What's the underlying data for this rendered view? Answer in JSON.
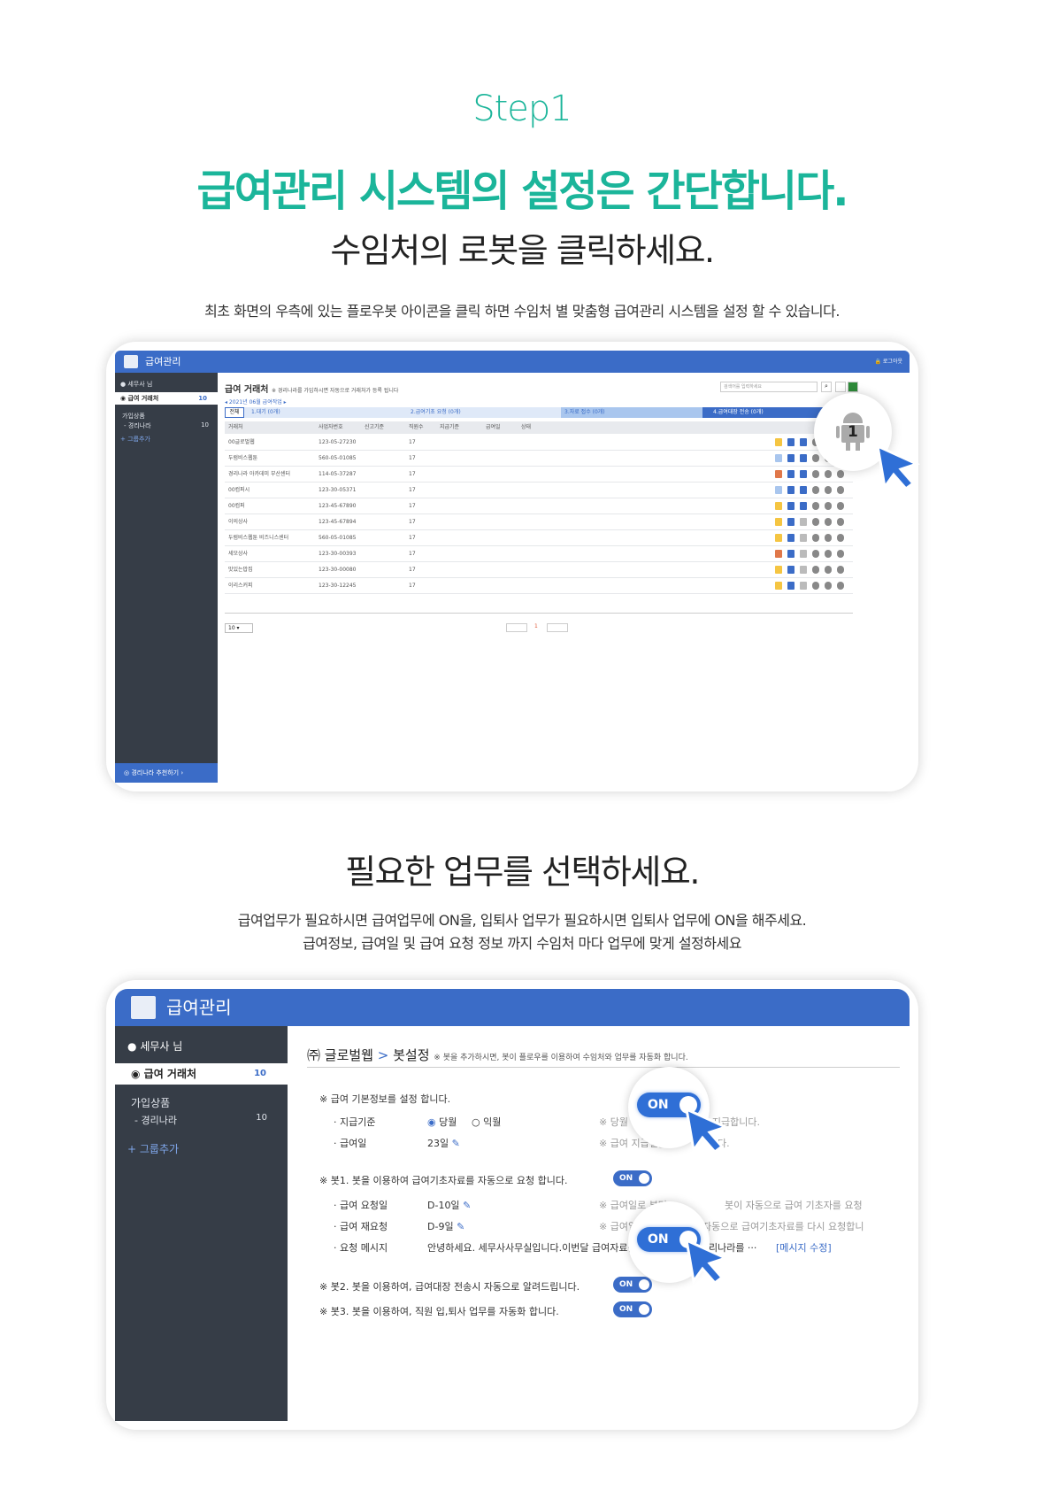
{
  "header": {
    "step": "Step1",
    "title": "급여관리 시스템의 설정은 간단합니다.",
    "subtitle1": "수임처의 로봇을 클릭하세요.",
    "desc1": "최초 화면의 우측에 있는 플로우봇 아이콘을 클릭 하면 수임처 별 맞춤형 급여관리 시스템을 설정 할 수 있습니다.",
    "subtitle2": "필요한 업무를 선택하세요.",
    "desc2_line1": "급여업무가 필요하시면 급여업무에 ON을, 입퇴사 업무가 필요하시면 입퇴사 업무에 ON을 해주세요.",
    "desc2_line2": "급여정보, 급여일 및 급여 요청 정보 까지 수임처 마다 업무에 맞게 설정하세요"
  },
  "screen1": {
    "app_title": "급여관리",
    "logout": "로그아웃",
    "user": "세무사 님",
    "menu_payroll": "급여 거래처",
    "menu_payroll_count": "10",
    "group_title": "가입상품",
    "group_item": "- 경리나라",
    "group_item_count": "10",
    "add_group": "+ 그룹추가",
    "recommend": "경리나라 추천하기",
    "page_title": "급여 거래처",
    "page_note": "※ 경리나라를 가입하시면 자동으로 거래처가 등록 됩니다",
    "search_placeholder": "검색어를 입력하세요",
    "month_nav": "◂ 2021년 06월 급여작업 ▸",
    "steps": [
      "전체",
      "1.대기 (0개)",
      "2.급여기초 요청 (0개)",
      "3.자료 접수 (0개)",
      "4.급여대장 전송 (0개)"
    ],
    "columns": [
      "거래처",
      "사업자번호",
      "신고기준",
      "직원수",
      "지급기준",
      "급여일",
      "상태"
    ],
    "rows": [
      {
        "name": "00글로벌웹",
        "biz": "123-05-27230",
        "cnt": "17"
      },
      {
        "name": "두럼비스웹툰",
        "biz": "560-05-01085",
        "cnt": "17"
      },
      {
        "name": "경리나라 아카데미 부산센터",
        "biz": "114-05-37287",
        "cnt": "17"
      },
      {
        "name": "00컴퍼시",
        "biz": "123-30-05371",
        "cnt": "17"
      },
      {
        "name": "00컴퍼",
        "biz": "123-45-67890",
        "cnt": "17"
      },
      {
        "name": "이의상사",
        "biz": "123-45-67894",
        "cnt": "17"
      },
      {
        "name": "두럼비스웹툰 비즈니스센터",
        "biz": "560-05-01085",
        "cnt": "17"
      },
      {
        "name": "세모상사",
        "biz": "123-30-00393",
        "cnt": "17"
      },
      {
        "name": "맛있는밥집",
        "biz": "123-30-00080",
        "cnt": "17"
      },
      {
        "name": "이리스커피",
        "biz": "123-30-12245",
        "cnt": "17"
      }
    ],
    "page_size": "10",
    "page_num": "1",
    "robot_badge": "1"
  },
  "screen2": {
    "app_title": "급여관리",
    "user": "세무사 님",
    "menu_payroll": "급여 거래처",
    "menu_payroll_count": "10",
    "group_title": "가입상품",
    "group_item": "- 경리나라",
    "group_item_count": "10",
    "add_group": "그룹추가",
    "page_company": "㈜ 글로벌웹",
    "page_sep": ">",
    "page_title": "봇설정",
    "page_note": "※ 봇을 추가하시면, 봇이 플로우를 이용하여 수임처와 업무를 자동화 합니다.",
    "sec1": "※ 급여 기본정보를 설정 합니다.",
    "pay_basis_label": "· 지급기준",
    "pay_basis_opt1": "당월",
    "pay_basis_opt2": "익월",
    "pay_basis_note": "※ 당월 급여 귀속분을 당월 지급합니다.",
    "payday_label": "· 급여일",
    "payday_value": "23일",
    "payday_note": "※ 급여 지급일을",
    "payday_note_end": "다.",
    "bot1": "※ 봇1. 봇을 이용하여 급여기초자료를 자동으로 요청 합니다.",
    "req_label": "· 급여 요청일",
    "req_value": "D-10일",
    "req_note": "※ 급여일로 부터",
    "req_note_end": "봇이 자동으로 급여 기초자를 요청",
    "rereq_label": "· 급여 재요청",
    "rereq_value": "D-9일",
    "rereq_note": "※ 급여일 전 D-9일 봇이 자동으로 급여기초자료를 다시 요청합니",
    "msg_label": "· 요청 메시지",
    "msg_value": "안녕하세요. 세무사사무실입니다.이번달 급여자료를 요청 드립니다.경리나라를 ···",
    "msg_edit": "[메시지 수정]",
    "bot2": "※ 봇2. 봇을 이용하여, 급여대장 전송시 자동으로 알려드립니다.",
    "bot3": "※ 봇3. 봇을 이용하여, 직원 입,퇴사 업무를 자동화 합니다.",
    "toggle_on": "ON"
  },
  "colors": {
    "accent": "#1bb59a",
    "highlight": "#f3ef3b",
    "app_blue": "#3b6cc7",
    "sidebar": "#363d47"
  }
}
